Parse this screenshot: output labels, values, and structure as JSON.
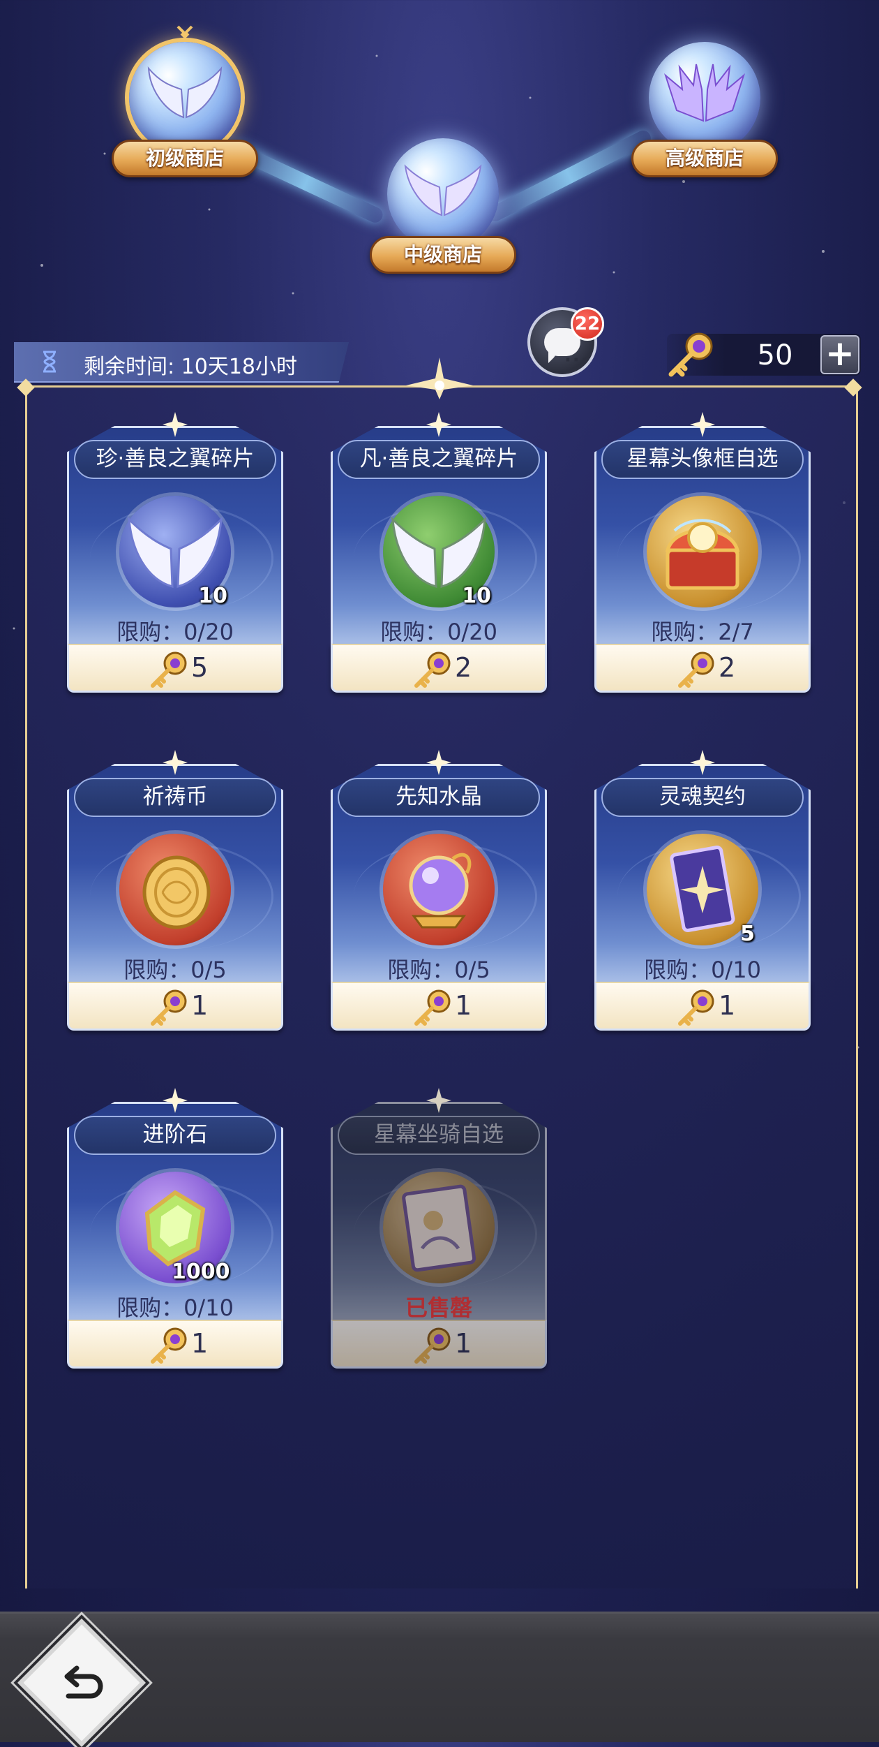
{
  "shops": [
    {
      "label": "初级商店",
      "selected": true
    },
    {
      "label": "中级商店",
      "selected": false
    },
    {
      "label": "高级商店",
      "selected": false
    }
  ],
  "status": {
    "timer_text": "剩余时间: 10天18小时",
    "chat_badge": "22",
    "currency_amount": "50",
    "plus_label": "+"
  },
  "items": [
    {
      "name": "珍·善良之翼碎片",
      "qty": "10",
      "limit": "限购：0/20",
      "price": "5",
      "icon": "white-wings-icon"
    },
    {
      "name": "凡·善良之翼碎片",
      "qty": "10",
      "limit": "限购：0/20",
      "price": "2",
      "icon": "green-wings-icon"
    },
    {
      "name": "星幕头像框自选",
      "qty": "",
      "limit": "限购：2/7",
      "price": "2",
      "icon": "treasure-chest-icon"
    },
    {
      "name": "祈祷币",
      "qty": "",
      "limit": "限购：0/5",
      "price": "1",
      "icon": "prayer-coin-icon"
    },
    {
      "name": "先知水晶",
      "qty": "",
      "limit": "限购：0/5",
      "price": "1",
      "icon": "crystal-ball-icon"
    },
    {
      "name": "灵魂契约",
      "qty": "5",
      "limit": "限购：0/10",
      "price": "1",
      "icon": "soul-contract-card-icon"
    },
    {
      "name": "进阶石",
      "qty": "1000",
      "limit": "限购：0/10",
      "price": "1",
      "icon": "green-gem-icon"
    },
    {
      "name": "星幕坐骑自选",
      "qty": "",
      "limit": "已售罄",
      "price": "1",
      "icon": "mount-card-icon",
      "sold_out": true
    }
  ],
  "colors": {
    "accent_gold": "#e6a956",
    "sold_out_red": "#d1322c",
    "panel_border": "#e5cd92"
  }
}
